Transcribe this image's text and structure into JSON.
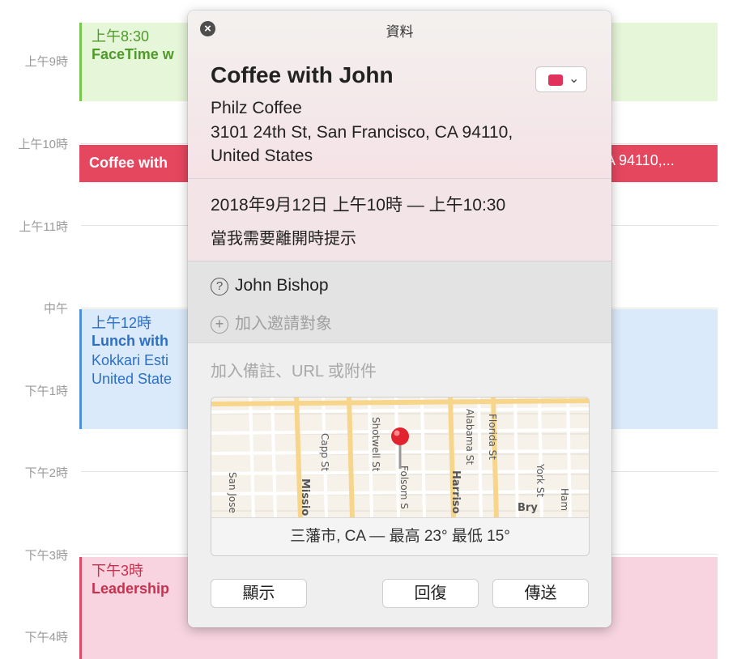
{
  "calendar": {
    "hours": [
      "上午9時",
      "上午10時",
      "上午11時",
      "中午",
      "下午1時",
      "下午2時",
      "下午3時",
      "下午4時"
    ],
    "events": {
      "facetime": {
        "time": "上午8:30",
        "title": "FaceTime w"
      },
      "coffee": {
        "title": "Coffee with",
        "trailing": "A  94110,..."
      },
      "lunch": {
        "time": "上午12時",
        "title": "Lunch with",
        "location1": "Kokkari Esti",
        "location2": "United State"
      },
      "leadership": {
        "time": "下午3時",
        "title": "Leadership"
      }
    }
  },
  "popover": {
    "header": "資料",
    "close_icon": "close-icon",
    "event_title": "Coffee with John",
    "color": "#e0325a",
    "location_name": "Philz Coffee",
    "address_line1": "3101 24th St, San Francisco, CA  94110,",
    "address_line2": "United States",
    "date_time": "2018年9月12日  上午10時 — 上午10:30",
    "alert": "當我需要離開時提示",
    "invitee": "John Bishop",
    "add_invitees": "加入邀請對象",
    "notes_placeholder": "加入備註、URL 或附件",
    "map": {
      "streets": [
        "San Jose",
        "Missio",
        "Capp St",
        "Shotwell St",
        "Folsom S",
        "Harriso",
        "Alabama St",
        "Florida St",
        "York St",
        "Bry",
        "Ham"
      ],
      "weather": "三藩市, CA — 最高 23° 最低 15°"
    },
    "buttons": {
      "show": "顯示",
      "reply": "回復",
      "send": "傳送"
    }
  }
}
